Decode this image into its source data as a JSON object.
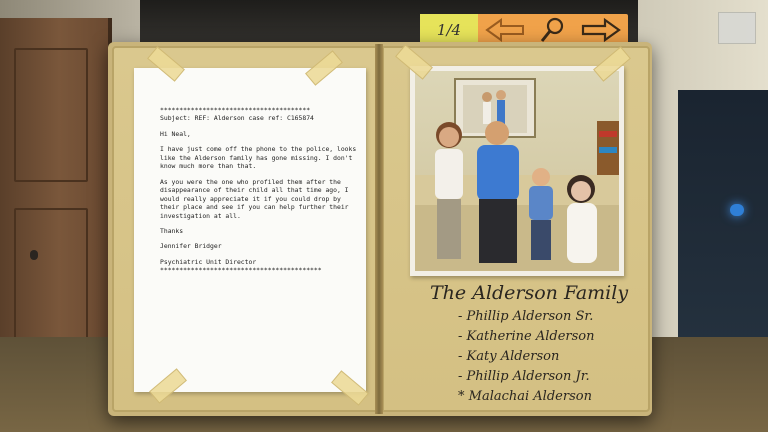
{
  "toolbar": {
    "page_counter": "1/4",
    "back_icon": "arrow-left-icon",
    "search_icon": "magnifier-icon",
    "next_icon": "arrow-right-icon",
    "accent_color": "#f0a24a",
    "counter_color": "#e6e35a"
  },
  "letter": {
    "stars_top": "***************************************",
    "subject": "Subject: REF: Alderson case ref: C165874",
    "greeting": "Hi Neal,",
    "paragraph1": "I have just come off the phone to the police, looks like the Alderson family has gone missing. I don't know much more than that.",
    "paragraph2": "As you were the one who profiled them after the disappearance of their child all that time ago, I would really appreciate it if you could drop by their place and see if you can help further their investigation at all.",
    "signoff": "Thanks",
    "signature": "Jennifer Bridger",
    "role": "Psychiatric Unit Director",
    "stars_bottom": "******************************************"
  },
  "family": {
    "title": "The Alderson Family",
    "members": [
      "- Phillip Alderson Sr.",
      "- Katherine Alderson",
      "- Katy Alderson",
      "- Phillip Alderson Jr.",
      "* Malachai Alderson"
    ]
  }
}
